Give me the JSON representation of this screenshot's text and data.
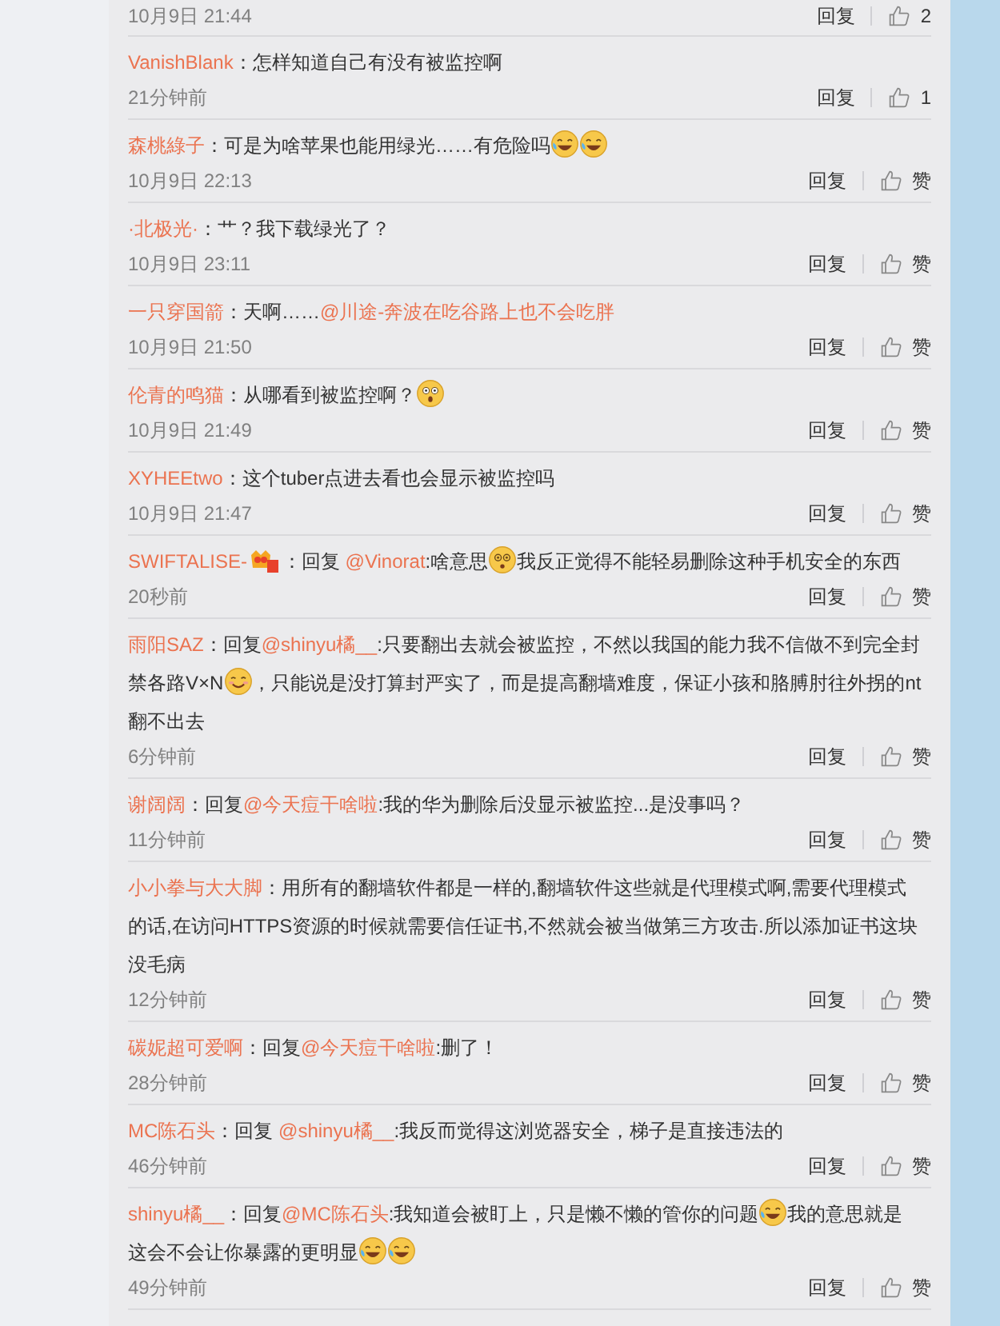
{
  "comments": [
    {
      "time": "10月9日 21:44",
      "reply": "回复",
      "likes": "2"
    },
    {
      "parts": [
        {
          "kind": "user",
          "text": "VanishBlank"
        },
        {
          "kind": "text",
          "text": "：怎样知道自己有没有被监控啊"
        }
      ],
      "time": "21分钟前",
      "reply": "回复",
      "likes": "1"
    },
    {
      "parts": [
        {
          "kind": "user",
          "text": "森桃綠子"
        },
        {
          "kind": "text",
          "text": "：可是为啥苹果也能用绿光……有危险吗"
        },
        {
          "kind": "laugh_emoji"
        },
        {
          "kind": "laugh_emoji"
        }
      ],
      "time": "10月9日 22:13",
      "reply": "回复",
      "likes": "赞"
    },
    {
      "parts": [
        {
          "kind": "user",
          "text": "·北极光·"
        },
        {
          "kind": "text",
          "text": "：艹？我下载绿光了？"
        }
      ],
      "time": "10月9日 23:11",
      "reply": "回复",
      "likes": "赞"
    },
    {
      "parts": [
        {
          "kind": "user",
          "text": "一只穿国箭"
        },
        {
          "kind": "text",
          "text": "：天啊……"
        },
        {
          "kind": "mention",
          "text": "@川途-奔波在吃谷路上也不会吃胖"
        }
      ],
      "time": "10月9日 21:50",
      "reply": "回复",
      "likes": "赞"
    },
    {
      "parts": [
        {
          "kind": "user",
          "text": "伦青的鸣猫"
        },
        {
          "kind": "text",
          "text": "：从哪看到被监控啊？"
        },
        {
          "kind": "shocked_emoji"
        }
      ],
      "time": "10月9日 21:49",
      "reply": "回复",
      "likes": "赞"
    },
    {
      "parts": [
        {
          "kind": "user",
          "text": "XYHEEtwo"
        },
        {
          "kind": "text",
          "text": "：这个tuber点进去看也会显示被监控吗"
        }
      ],
      "time": "10月9日 21:47",
      "reply": "回复",
      "likes": "赞"
    },
    {
      "parts": [
        {
          "kind": "user",
          "text": "SWIFTALISE-"
        },
        {
          "kind": "badge"
        },
        {
          "kind": "text",
          "text": "：回复 "
        },
        {
          "kind": "mention",
          "text": "@Vinorat"
        },
        {
          "kind": "text",
          "text": ":啥意思"
        },
        {
          "kind": "dizzy_emoji"
        },
        {
          "kind": "text",
          "text": "我反正觉得不能轻易删除这种手机安全的东西"
        }
      ],
      "time": "20秒前",
      "reply": "回复",
      "likes": "赞"
    },
    {
      "parts": [
        {
          "kind": "user",
          "text": "雨阳SAZ"
        },
        {
          "kind": "text",
          "text": "：回复"
        },
        {
          "kind": "mention",
          "text": "@shinyu橘__"
        },
        {
          "kind": "text",
          "text": ":只要翻出去就会被监控，不然以我国的能力我不信做不到完全封禁各路V×N"
        },
        {
          "kind": "smile_emoji"
        },
        {
          "kind": "text",
          "text": "，只能说是没打算封严实了，而是提高翻墙难度，保证小孩和胳膊肘往外拐的nt翻不出去"
        }
      ],
      "time": "6分钟前",
      "reply": "回复",
      "likes": "赞"
    },
    {
      "parts": [
        {
          "kind": "user",
          "text": "谢阔阔"
        },
        {
          "kind": "text",
          "text": "：回复"
        },
        {
          "kind": "mention",
          "text": "@今天痘干啥啦"
        },
        {
          "kind": "text",
          "text": ":我的华为删除后没显示被监控...是没事吗？"
        }
      ],
      "time": "11分钟前",
      "reply": "回复",
      "likes": "赞"
    },
    {
      "parts": [
        {
          "kind": "user",
          "text": "小小拳与大大脚"
        },
        {
          "kind": "text",
          "text": "：用所有的翻墙软件都是一样的,翻墙软件这些就是代理模式啊,需要代理模式的话,在访问HTTPS资源的时候就需要信任证书,不然就会被当做第三方攻击.所以添加证书这块没毛病"
        }
      ],
      "time": "12分钟前",
      "reply": "回复",
      "likes": "赞"
    },
    {
      "parts": [
        {
          "kind": "user",
          "text": "碳妮超可爱啊"
        },
        {
          "kind": "text",
          "text": "：回复"
        },
        {
          "kind": "mention",
          "text": "@今天痘干啥啦"
        },
        {
          "kind": "text",
          "text": ":删了！"
        }
      ],
      "time": "28分钟前",
      "reply": "回复",
      "likes": "赞"
    },
    {
      "parts": [
        {
          "kind": "user",
          "text": "MC陈石头"
        },
        {
          "kind": "text",
          "text": "：回复 "
        },
        {
          "kind": "mention",
          "text": "@shinyu橘__"
        },
        {
          "kind": "text",
          "text": ":我反而觉得这浏览器安全，梯子是直接违法的"
        }
      ],
      "time": "46分钟前",
      "reply": "回复",
      "likes": "赞"
    },
    {
      "parts": [
        {
          "kind": "user",
          "text": "shinyu橘__"
        },
        {
          "kind": "text",
          "text": "：回复"
        },
        {
          "kind": "mention",
          "text": "@MC陈石头"
        },
        {
          "kind": "text",
          "text": ":我知道会被盯上，只是懒不懒的管你的问题"
        },
        {
          "kind": "laugh_emoji"
        },
        {
          "kind": "text",
          "text": "我的意思就是这会不会让你暴露的更明显"
        },
        {
          "kind": "laugh_emoji"
        },
        {
          "kind": "laugh_emoji"
        }
      ],
      "time": "49分钟前",
      "reply": "回复",
      "likes": "赞"
    }
  ]
}
